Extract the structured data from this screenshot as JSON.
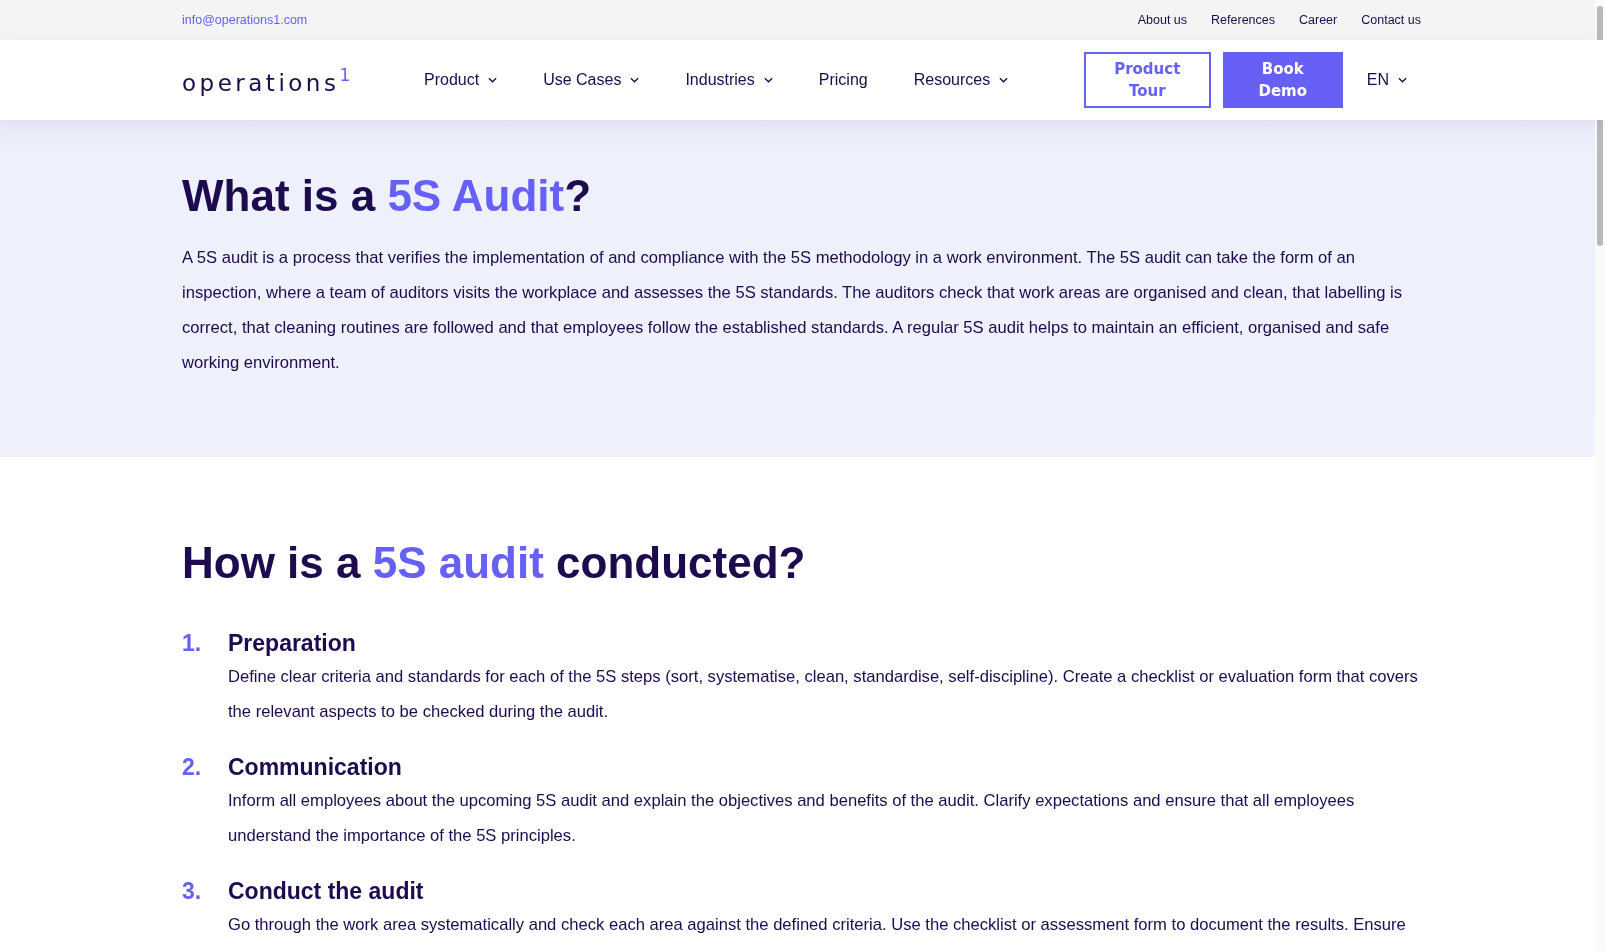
{
  "top_bar": {
    "email": "info@operations1.com",
    "links": [
      "About us",
      "References",
      "Career",
      "Contact us"
    ]
  },
  "nav": {
    "logo": "operations$^{1}$",
    "items": [
      {
        "label": "Product",
        "dropdown": true
      },
      {
        "label": "Use Cases",
        "dropdown": true
      },
      {
        "label": "Industries",
        "dropdown": true
      },
      {
        "label": "Pricing",
        "dropdown": false
      },
      {
        "label": "Resources",
        "dropdown": true
      }
    ],
    "buttons": [
      {
        "label": "Product Tour",
        "kind": "outline"
      },
      {
        "label": "Book Demo",
        "kind": "filled"
      }
    ],
    "language": "EN"
  },
  "hero": {
    "title": [
      {
        "text": "What is a ",
        "highlight": false
      },
      {
        "text": "5S Audit",
        "highlight": true
      },
      {
        "text": "?",
        "highlight": false
      }
    ],
    "text": "A 5S audit is a process that verifies the implementation of and compliance with the 5S methodology in a work environment. The 5S audit can take the form of an inspection, where a team of auditors visits the workplace and assesses the 5S standards. The auditors check that work areas are organised and clean, that labelling is correct, that cleaning routines are followed and that employees follow the established standards. A regular 5S audit helps to maintain an efficient, organised and safe working environment."
  },
  "section": {
    "title": [
      {
        "text": "How is a ",
        "highlight": false
      },
      {
        "text": "5S audit",
        "highlight": true
      },
      {
        "text": " conducted?",
        "highlight": false
      }
    ],
    "steps": [
      {
        "number": "1.",
        "title": "Preparation",
        "text": "Define clear criteria and standards for each of the 5S steps (sort, systematise, clean, standardise, self-discipline). Create a checklist or evaluation form that covers the relevant aspects to be checked during the audit."
      },
      {
        "number": "2.",
        "title": "Communication",
        "text": "Inform all employees about the upcoming 5S audit and explain the objectives and benefits of the audit. Clarify expectations and ensure that all employees understand the importance of the 5S principles."
      },
      {
        "number": "3.",
        "title": "Conduct the audit",
        "text": "Go through the work area systematically and check each area against the defined criteria. Use the checklist or assessment form to document the results. Ensure"
      }
    ]
  }
}
